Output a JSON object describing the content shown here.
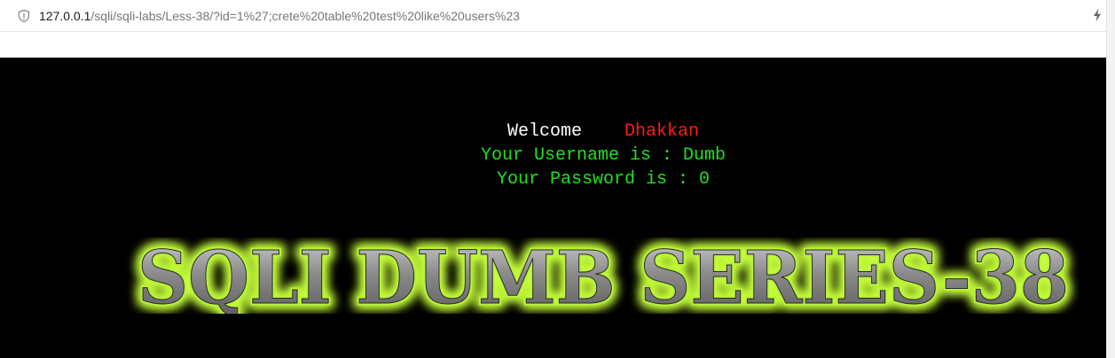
{
  "browser": {
    "url_host": "127.0.0.1",
    "url_rest": "/sqli/sqli-labs/Less-38/?id=1%27;crete%20table%20test%20like%20users%23",
    "site_icon": "shield-icon",
    "action_icon": "lightning-icon"
  },
  "page": {
    "welcome_label": "Welcome",
    "welcome_name": "Dhakkan",
    "username_line": "Your Username is : Dumb",
    "password_line": "Your Password is : 0",
    "banner_text": "SQLI DUMB SERIES-38",
    "colors": {
      "background": "#000000",
      "welcome_label": "#ffffff",
      "welcome_name": "#ff1a1a",
      "result_text": "#20e020",
      "banner_glow": "#c6ff3a"
    }
  }
}
